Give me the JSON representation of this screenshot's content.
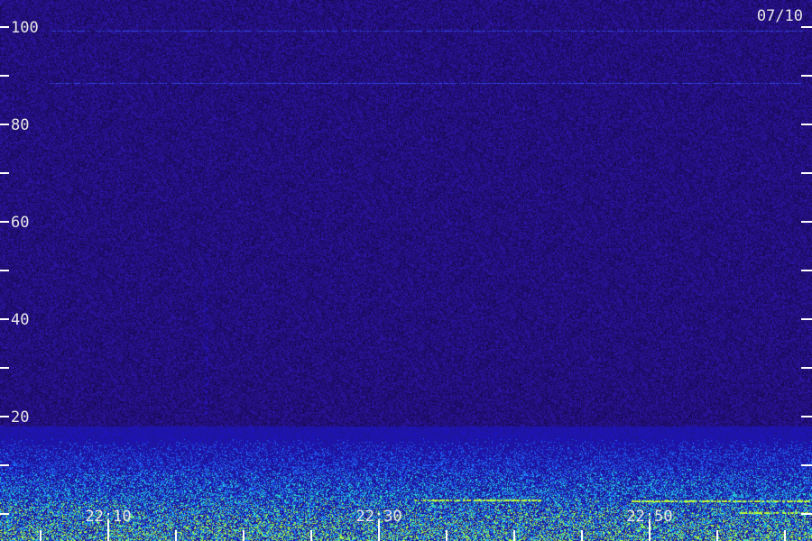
{
  "date_label": "07/10",
  "chart_data": {
    "type": "heatmap",
    "title": "",
    "xlabel": "",
    "ylabel": "",
    "ylim": [
      0,
      105
    ],
    "y_ticks_major": [
      20,
      40,
      60,
      80,
      100
    ],
    "y_ticks_minor": [
      0,
      10,
      30,
      50,
      70,
      90
    ],
    "x_tick_labels": [
      "22:10",
      "22:30",
      "22:50"
    ],
    "x_range_minutes": [
      22,
      82
    ],
    "x_major_minutes": [
      30,
      50,
      70
    ],
    "x_minor_minutes": [
      25,
      35,
      40,
      45,
      55,
      60,
      65,
      75,
      80
    ],
    "noise_floor_color": "#1e0f6e",
    "activity_band_max": 18,
    "colors": {
      "background": "#1a0c5c",
      "low": "#2a1ab0",
      "mid": "#1f6fff",
      "high": "#27e0d0",
      "peak": "#b8ff30",
      "text": "#e8e8e8"
    }
  }
}
